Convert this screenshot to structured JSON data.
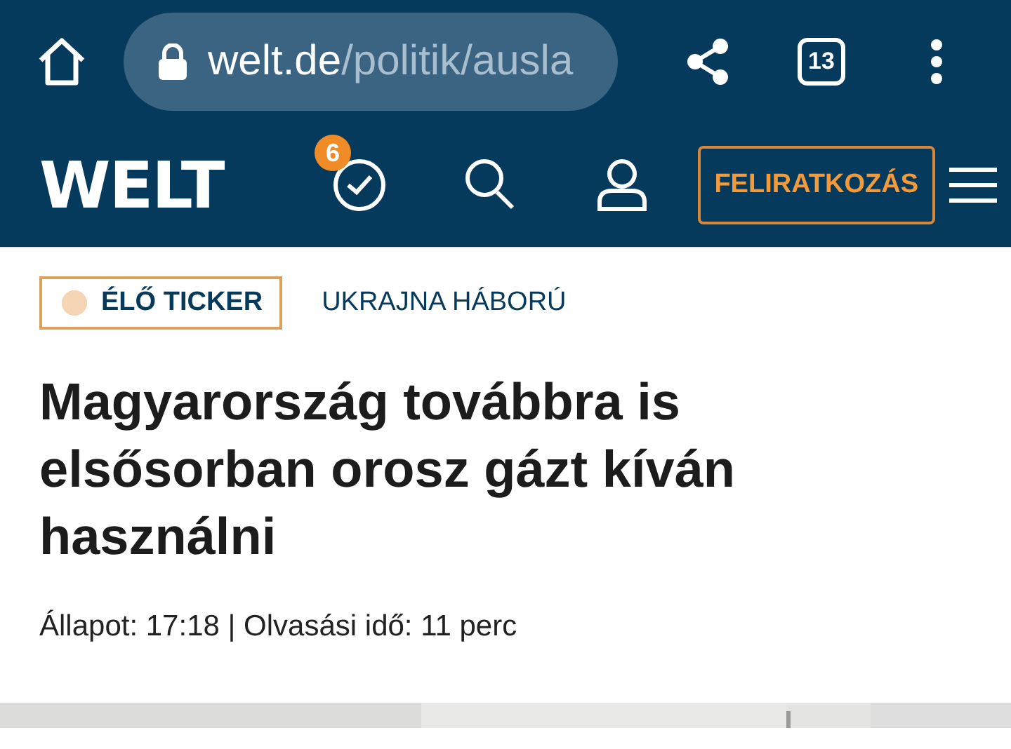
{
  "browser": {
    "url_host": "welt.de",
    "url_path": "/politik/ausla",
    "tab_count": "13"
  },
  "site_header": {
    "logo": "WELT",
    "history_badge": "6",
    "subscribe": "FELIRATKOZÁS"
  },
  "article": {
    "live_label": "ÉLŐ TICKER",
    "category": "UKRAJNA HÁBORÚ",
    "title": "Magyarország továbbra is elsősorban orosz gázt kíván használni",
    "meta": "Állapot: 17:18 | Olvasási idő: 11 perc"
  }
}
